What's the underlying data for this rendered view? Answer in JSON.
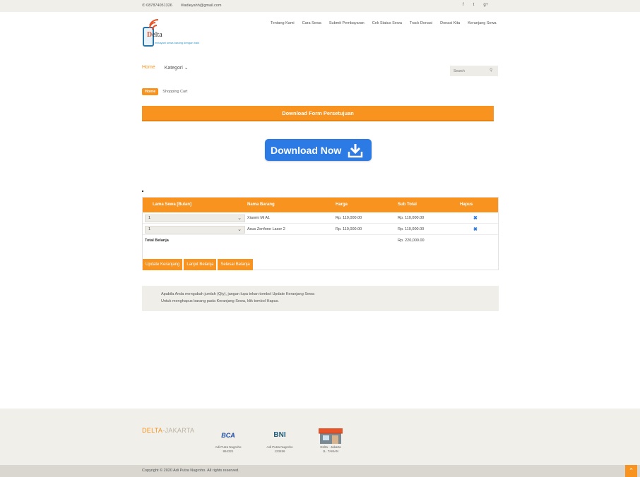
{
  "topbar": {
    "phone": "087874051326",
    "email": "adieyahh@gmail.com",
    "social": [
      "f",
      "t",
      "g+"
    ]
  },
  "logo": {
    "brand_first": "D",
    "brand_rest": "elta",
    "tagline": "melayani sewa barang dengan baik"
  },
  "nav": {
    "items": [
      "Tentang Kami",
      "Cara Sewa",
      "Submit Pembayaran",
      "Cek Status Sewa",
      "Track Donasi",
      "Donasi Kita",
      "Keranjang Sewa"
    ]
  },
  "subnav": {
    "home": "Home",
    "category": "Kategori"
  },
  "search": {
    "placeholder": "Search"
  },
  "breadcrumb": {
    "home": "Home",
    "current": "Shopping Cart"
  },
  "form_bar": {
    "label": "Download Form Persetujuan"
  },
  "download_button": {
    "label": "Download Now"
  },
  "cart": {
    "headers": [
      "Lama Sewa [Bulan]",
      "Nama Barang",
      "Harga",
      "Sub Total",
      "Hapus"
    ],
    "rows": [
      {
        "qty": "1",
        "name": "Xiaomi Mi A1",
        "price": "Rp. 110,000.00",
        "subtotal": "Rp. 110,000.00"
      },
      {
        "qty": "1",
        "name": "Asus Zenfone Laser 2",
        "price": "Rp. 110,000.00",
        "subtotal": "Rp. 110,000.00"
      }
    ],
    "total_label": "Total Belanja",
    "total_value": "Rp. 220,000.00",
    "actions": [
      "Update Keranjang",
      "Lanjut Belanja",
      "Selesai Belanja"
    ]
  },
  "notice": {
    "line1": "Apabila Anda mengubah jumlah (Qty), jangan lupa tekan tombol Update Keranjang Sewa",
    "line2": "Untuk menghapus barang pada Keranjang Sewa, klik tombol Hapus."
  },
  "footer": {
    "logo_main": "DELTA",
    "logo_sub": "-JAKARTA",
    "banks": [
      {
        "logo": "BCA",
        "holder": "Adi Putra Nugroho",
        "number": "864321"
      },
      {
        "logo": "BNI",
        "holder": "Adi Putra Nugroho",
        "number": "123456"
      },
      {
        "logo": "store",
        "holder": "Delta - Jakarta",
        "number": "JL. TAMAN"
      }
    ]
  },
  "copyright": "Copyright © 2020 Adi Putra Nugroho. All rights reserved.",
  "colors": {
    "accent": "#f7931e",
    "download_blue": "#2c7be5",
    "band": "#f1efe9"
  }
}
